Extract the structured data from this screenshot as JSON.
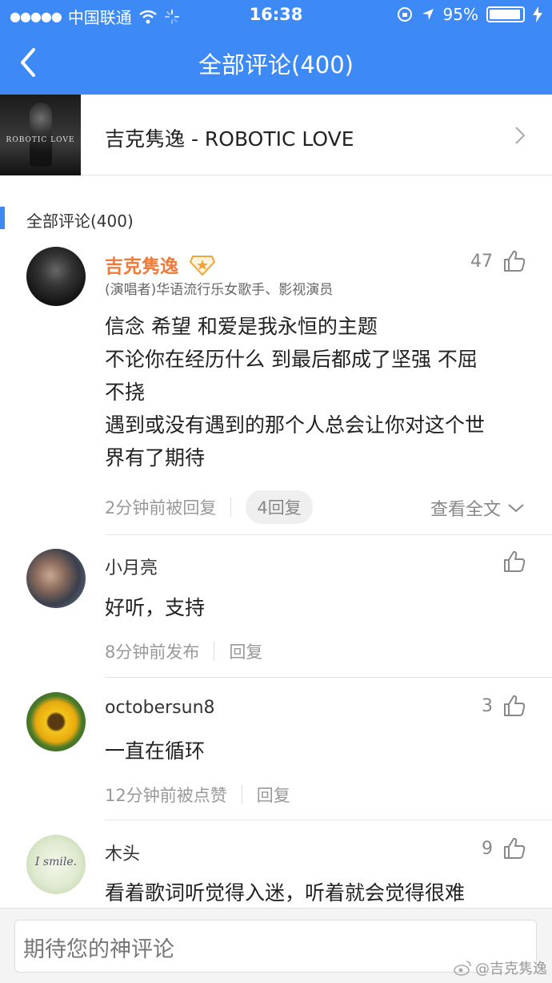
{
  "status_bar": {
    "signal": "●●●●●",
    "carrier": "中国联通",
    "time": "16:38",
    "battery_percent": "95%",
    "battery_level": 0.95
  },
  "nav": {
    "title": "全部评论(400)"
  },
  "song": {
    "cover_text": "ROBOTIC LOVE",
    "title": "吉克隽逸 - ROBOTIC LOVE"
  },
  "section_label": "全部评论(400)",
  "comments": [
    {
      "user": "吉克隽逸",
      "verified_badge": "diamond-badge",
      "subtitle": "(演唱者)华语流行乐女歌手、影视演员",
      "likes": "47",
      "text_lines": [
        "信念 希望 和爱是我永恒的主题",
        "不论你在经历什么 到最后都成了坚强 不屈",
        "不挠",
        "遇到或没有遇到的那个人总会让你对这个世",
        "界有了期待"
      ],
      "time": "2分钟前被回复",
      "replies": "4回复",
      "expand": "查看全文"
    },
    {
      "user": "小月亮",
      "likes": "",
      "text": "好听，支持",
      "time": "8分钟前发布",
      "reply": "回复"
    },
    {
      "user": "octobersun8",
      "likes": "3",
      "text": "一直在循环",
      "time": "12分钟前被点赞",
      "reply": "回复"
    },
    {
      "user": "木头",
      "avatar_text": "I smile.",
      "likes": "9",
      "text": "看着歌词听觉得入迷，听着就会觉得很难"
    }
  ],
  "footer": {
    "placeholder": "期待您的神评论"
  },
  "watermark": "@吉克隽逸",
  "colors": {
    "header": "#3d8af7",
    "artist_name": "#f07b3a"
  }
}
